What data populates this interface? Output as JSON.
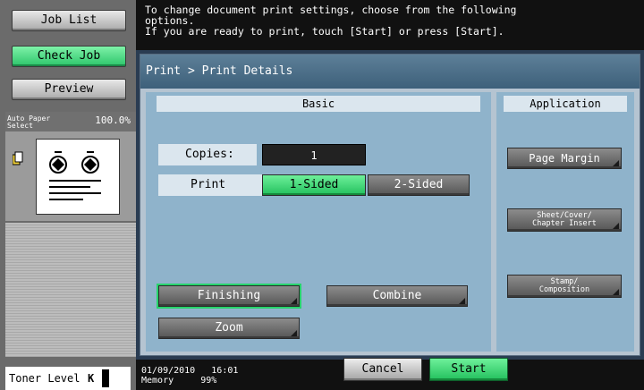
{
  "sidebar": {
    "job_list": "Job List",
    "check_job": "Check Job",
    "preview": "Preview",
    "paper_mode_line1": "Auto Paper",
    "paper_mode_line2": "Select",
    "zoom_percent": "100.0%",
    "toner_label": "Toner Level",
    "toner_color": "K"
  },
  "message": {
    "line1": "To change document print settings, choose from the following",
    "line2": "options.",
    "line3": "If you are ready to print, touch [Start] or press [Start]."
  },
  "breadcrumb": "Print > Print Details",
  "basic": {
    "tab_label": "Basic",
    "copies_label": "Copies:",
    "copies_value": "1",
    "print_label": "Print",
    "one_sided": "1-Sided",
    "two_sided": "2-Sided",
    "finishing": "Finishing",
    "combine": "Combine",
    "zoom": "Zoom"
  },
  "application": {
    "tab_label": "Application",
    "page_margin": "Page Margin",
    "sheet_cover_line1": "Sheet/Cover/",
    "sheet_cover_line2": "Chapter Insert",
    "stamp_line1": "Stamp/",
    "stamp_line2": "Composition"
  },
  "status": {
    "date": "01/09/2010",
    "time": "16:01",
    "memory_label": "Memory",
    "memory_value": "99%"
  },
  "actions": {
    "cancel": "Cancel",
    "start": "Start"
  },
  "colors": {
    "accent_green": "#22c05d",
    "panel_blue": "#8fb3cb",
    "header_blue": "#3d607a"
  }
}
